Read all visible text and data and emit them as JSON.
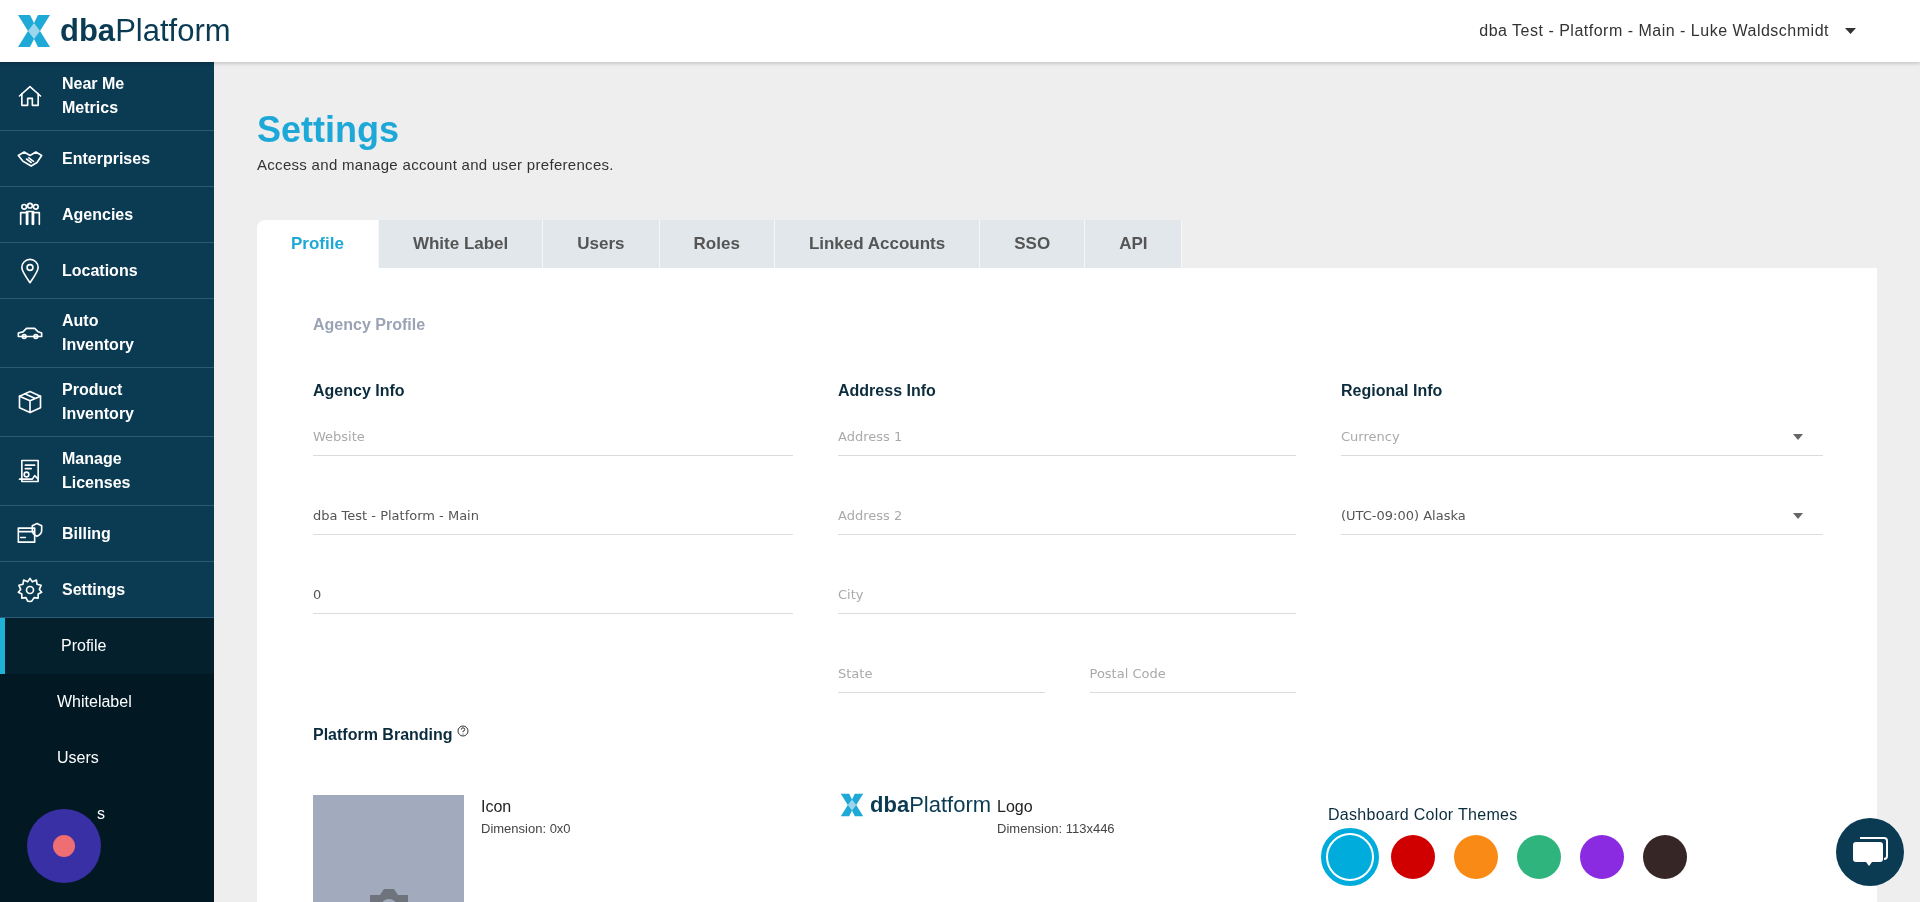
{
  "header": {
    "logo_bold": "dba",
    "logo_light": "Platform",
    "account": "dba Test - Platform - Main - Luke Waldschmidt"
  },
  "sidebar": {
    "items": [
      {
        "label": "Near Me Metrics"
      },
      {
        "label": "Enterprises"
      },
      {
        "label": "Agencies"
      },
      {
        "label": "Locations"
      },
      {
        "label": "Auto Inventory"
      },
      {
        "label": "Product Inventory"
      },
      {
        "label": "Manage Licenses"
      },
      {
        "label": "Billing"
      },
      {
        "label": "Settings"
      }
    ],
    "subitems": [
      {
        "label": "Profile",
        "selected": true
      },
      {
        "label": "Whitelabel",
        "selected": false
      },
      {
        "label": "Users",
        "selected": false
      },
      {
        "label": "s",
        "selected": false,
        "kind": "covered"
      }
    ]
  },
  "page": {
    "title": "Settings",
    "subtitle": "Access and manage account and user preferences."
  },
  "tabs": [
    {
      "label": "Profile",
      "selected": true
    },
    {
      "label": "White Label",
      "selected": false
    },
    {
      "label": "Users",
      "selected": false
    },
    {
      "label": "Roles",
      "selected": false
    },
    {
      "label": "Linked Accounts",
      "selected": false
    },
    {
      "label": "SSO",
      "selected": false
    },
    {
      "label": "API",
      "selected": false
    }
  ],
  "section_title": "Agency Profile",
  "columns": [
    {
      "heading": "Agency Info",
      "rows": [
        [
          {
            "kind": "text",
            "placeholder": "Website"
          }
        ],
        [
          {
            "kind": "text",
            "value": "dba Test - Platform - Main"
          }
        ],
        [
          {
            "kind": "text",
            "value": "0"
          }
        ]
      ]
    },
    {
      "heading": "Address Info",
      "rows": [
        [
          {
            "kind": "text",
            "placeholder": "Address 1"
          }
        ],
        [
          {
            "kind": "text",
            "placeholder": "Address 2"
          }
        ],
        [
          {
            "kind": "text",
            "placeholder": "City"
          }
        ],
        [
          {
            "kind": "text",
            "placeholder": "State"
          },
          {
            "kind": "text",
            "placeholder": "Postal Code"
          }
        ]
      ]
    },
    {
      "heading": "Regional Info",
      "rows": [
        [
          {
            "kind": "select",
            "placeholder": "Currency"
          }
        ],
        [
          {
            "kind": "select",
            "value": "(UTC-09:00) Alaska"
          }
        ]
      ]
    }
  ],
  "branding": {
    "title": "Platform Branding",
    "icon": {
      "label": "Icon",
      "dimension": "Dimension: 0x0"
    },
    "logo": {
      "bold": "dba",
      "light": "Platform",
      "label": "Logo",
      "dimension": "Dimension: 113x446"
    },
    "themes_title": "Dashboard Color Themes",
    "themes": [
      {
        "color": "#00acdc",
        "selected": true
      },
      {
        "color": "#d00000",
        "selected": false
      },
      {
        "color": "#f98a16",
        "selected": false
      },
      {
        "color": "#2fb47e",
        "selected": false
      },
      {
        "color": "#8a2be2",
        "selected": false
      },
      {
        "color": "#362626",
        "selected": false
      }
    ]
  }
}
